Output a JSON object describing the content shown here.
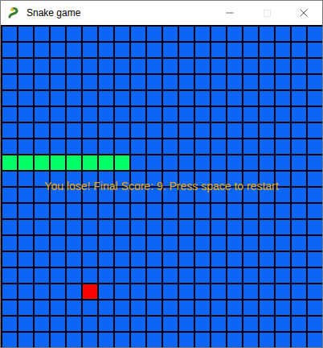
{
  "window": {
    "title": "Snake game"
  },
  "grid": {
    "columns": 20,
    "rows": 20
  },
  "snake": [
    {
      "col": 0,
      "row": 8
    },
    {
      "col": 1,
      "row": 8
    },
    {
      "col": 2,
      "row": 8
    },
    {
      "col": 3,
      "row": 8
    },
    {
      "col": 4,
      "row": 8
    },
    {
      "col": 5,
      "row": 8
    },
    {
      "col": 6,
      "row": 8
    },
    {
      "col": 7,
      "row": 8
    }
  ],
  "food": {
    "col": 5,
    "row": 16
  },
  "message": "You lose! Final Score: 9. Press space to restart"
}
